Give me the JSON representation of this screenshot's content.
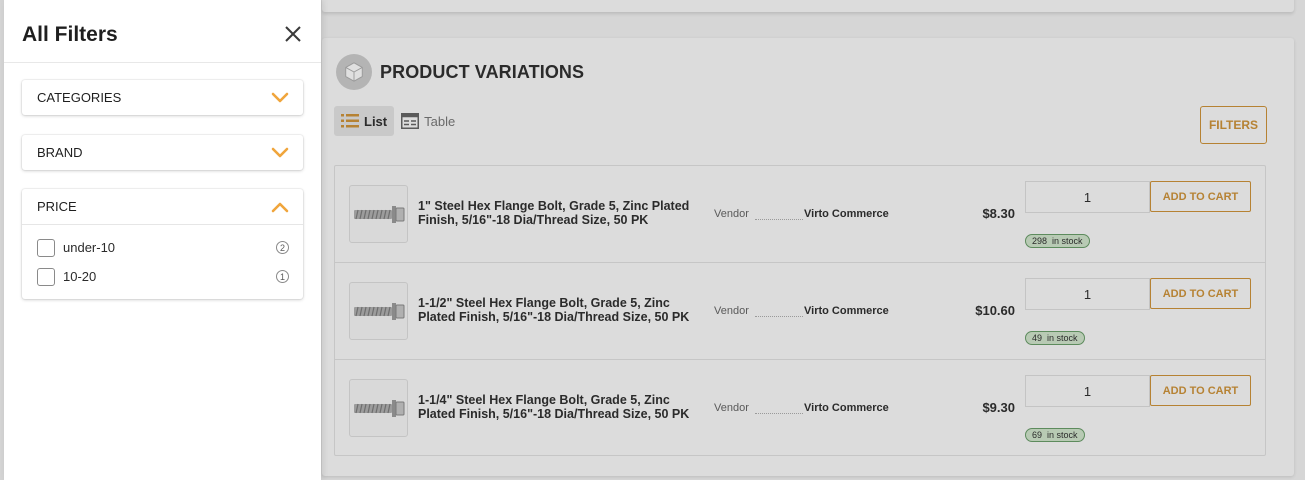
{
  "drawer": {
    "title": "All Filters",
    "close_icon": "close-icon",
    "facets": [
      {
        "label": "CATEGORIES",
        "expanded": false,
        "icon": "chevron-down-icon"
      },
      {
        "label": "BRAND",
        "expanded": false,
        "icon": "chevron-down-icon"
      },
      {
        "label": "PRICE",
        "expanded": true,
        "icon": "chevron-up-icon",
        "options": [
          {
            "label": "under-10",
            "count": "2",
            "checked": false
          },
          {
            "label": "10-20",
            "count": "1",
            "checked": false
          }
        ]
      }
    ]
  },
  "section": {
    "title": "PRODUCT VARIATIONS",
    "icon": "cube-icon",
    "view_list_label": "List",
    "view_table_label": "Table",
    "filters_button": "FILTERS"
  },
  "variations": [
    {
      "name": "1\" Steel Hex Flange Bolt, Grade 5, Zinc Plated Finish, 5/16\"-18 Dia/Thread Size, 50 PK",
      "vendor_label": "Vendor",
      "vendor": "Virto Commerce",
      "price": "$8.30",
      "qty": "1",
      "add_label": "ADD TO CART",
      "stock_count": "298",
      "stock_label": "in stock"
    },
    {
      "name": "1-1/2\" Steel Hex Flange Bolt, Grade 5, Zinc Plated Finish, 5/16\"-18 Dia/Thread Size, 50 PK",
      "vendor_label": "Vendor",
      "vendor": "Virto Commerce",
      "price": "$10.60",
      "qty": "1",
      "add_label": "ADD TO CART",
      "stock_count": "49",
      "stock_label": "in stock"
    },
    {
      "name": "1-1/4\" Steel Hex Flange Bolt, Grade 5, Zinc Plated Finish, 5/16\"-18 Dia/Thread Size, 50 PK",
      "vendor_label": "Vendor",
      "vendor": "Virto Commerce",
      "price": "$9.30",
      "qty": "1",
      "add_label": "ADD TO CART",
      "stock_count": "69",
      "stock_label": "in stock"
    }
  ],
  "colors": {
    "accent": "#f0a53c",
    "accent_dim": "#b68233",
    "overlay_bg": "#d6d6d6",
    "stock_badge_border": "#5d8b5d"
  }
}
